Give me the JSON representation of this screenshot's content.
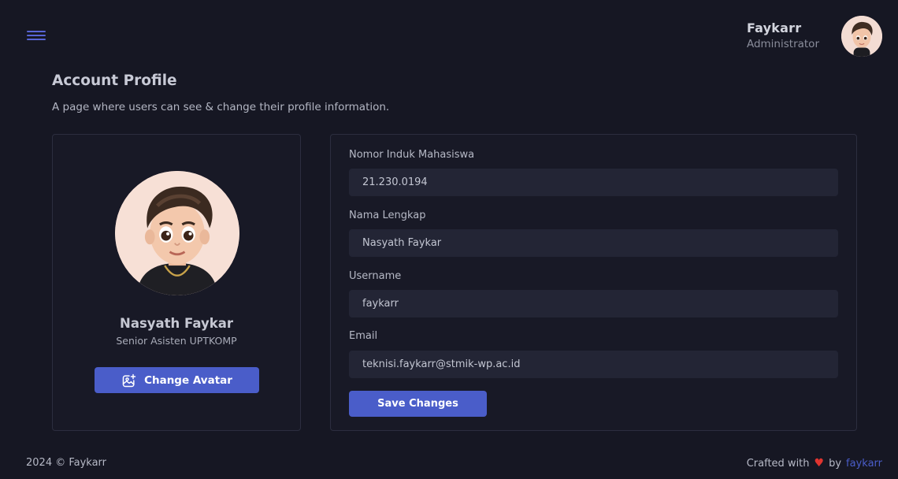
{
  "header": {
    "menu_icon": "hamburger-menu-icon",
    "user_name": "Faykarr",
    "user_role": "Administrator"
  },
  "page": {
    "title": "Account Profile",
    "subtitle": "A page where users can see & change their profile information."
  },
  "profile": {
    "name": "Nasyath Faykar",
    "position": "Senior Asisten UPTKOMP",
    "change_avatar_label": "Change Avatar",
    "change_avatar_icon": "image-edit-icon"
  },
  "form": {
    "nim": {
      "label": "Nomor Induk Mahasiswa",
      "value": "21.230.0194"
    },
    "full_name": {
      "label": "Nama Lengkap",
      "value": "Nasyath Faykar"
    },
    "username": {
      "label": "Username",
      "value": "faykarr"
    },
    "email": {
      "label": "Email",
      "value": "teknisi.faykarr@stmik-wp.ac.id"
    },
    "save_label": "Save Changes"
  },
  "footer": {
    "copyright": "2024 © Faykarr",
    "crafted_prefix": "Crafted with",
    "heart": "♥",
    "by": "by",
    "link_text": "faykarr"
  },
  "colors": {
    "background": "#161723",
    "card": "#181926",
    "accent": "#4a5dc9",
    "heart": "#e0342f"
  }
}
